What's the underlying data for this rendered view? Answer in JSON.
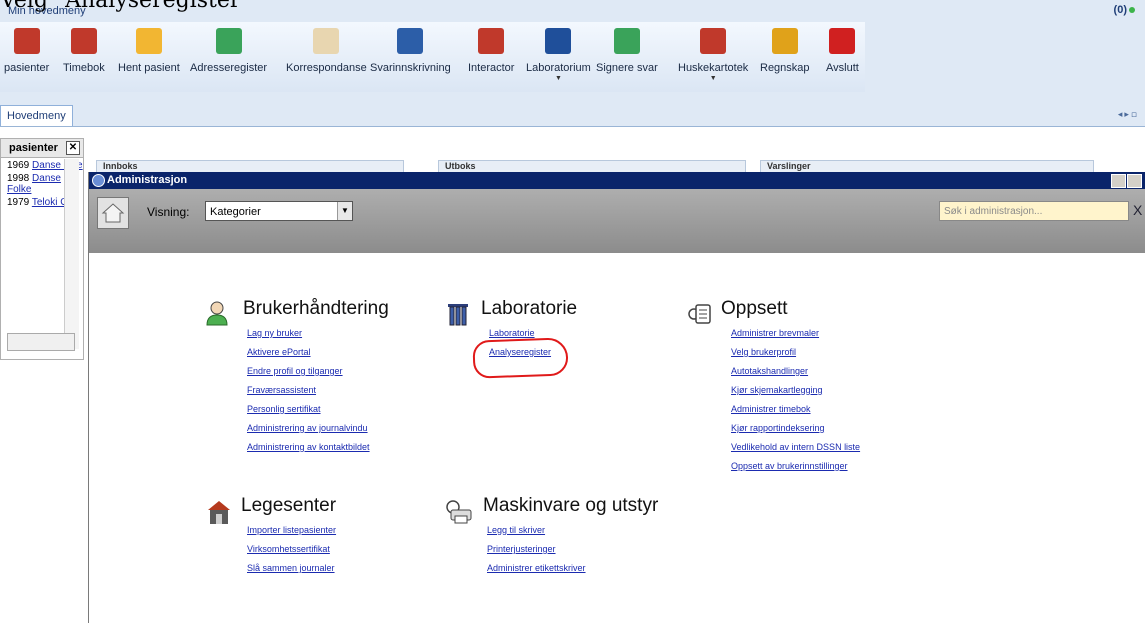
{
  "caption": "Velg \"Analyseregister\"",
  "app": {
    "title": "Min hovedmeny",
    "badge": "(0)"
  },
  "ribbon": [
    {
      "label": "pasienter",
      "icon": "calendar-icon",
      "color": "#c0392b"
    },
    {
      "label": "Timebok",
      "icon": "timebook-icon",
      "color": "#c0392b"
    },
    {
      "label": "Hent pasient",
      "icon": "fetch-patient-icon",
      "color": "#f2b632"
    },
    {
      "label": "Adresseregister",
      "icon": "address-book-icon",
      "color": "#3aa35a"
    },
    {
      "label": "Korrespondanse",
      "icon": "envelope-icon",
      "color": "#e8d6b0"
    },
    {
      "label": "Svarinnskrivning",
      "icon": "lab-entry-icon",
      "color": "#2c5ea8"
    },
    {
      "label": "Interactor",
      "icon": "interactor-icon",
      "color": "#c0392b"
    },
    {
      "label": "Laboratorium",
      "icon": "laboratory-icon",
      "color": "#1f4f9a",
      "has_menu": true
    },
    {
      "label": "Signere svar",
      "icon": "sign-check-icon",
      "color": "#3aa35a"
    },
    {
      "label": "Huskekartotek",
      "icon": "checklist-icon",
      "color": "#c0392b",
      "has_menu": true
    },
    {
      "label": "Regnskap",
      "icon": "coins-icon",
      "color": "#e0a21a"
    },
    {
      "label": "Avslutt",
      "icon": "exit-icon",
      "color": "#d02020"
    }
  ],
  "tabs": {
    "main": "Hovedmeny"
  },
  "left_pane": {
    "title": "pasienter",
    "rows": [
      {
        "year": "1969",
        "name": "Danse Line"
      },
      {
        "year": "1998",
        "name": "Danse Folke"
      },
      {
        "year": "1979",
        "name": "Teloki Gry"
      }
    ]
  },
  "background_panels": {
    "a": "Innboks",
    "b": "Utboks",
    "c": "Varslinger"
  },
  "admin": {
    "title": "Administrasjon",
    "visning_label": "Visning:",
    "visning_value": "Kategorier",
    "search_placeholder": "Søk i administrasjon...",
    "search_clear": "X",
    "categories": {
      "brukerhandtering": {
        "title": "Brukerhåndtering",
        "links": [
          "Lag ny bruker",
          "Aktivere ePortal",
          "Endre profil og tilganger",
          "Fraværsassistent",
          "Personlig sertifikat",
          "Administrering av journalvindu",
          "Administrering av kontaktbildet"
        ]
      },
      "laboratorie": {
        "title": "Laboratorie",
        "links": [
          "Laboratorie",
          "Analyseregister"
        ]
      },
      "oppsett": {
        "title": "Oppsett",
        "links": [
          "Administrer brevmaler",
          "Velg brukerprofil",
          "Autotakshandlinger",
          "Kjør skjemakartlegging",
          "Administrer timebok",
          "Kjør rapportindeksering",
          "Vedlikehold av intern DSSN liste",
          "Oppsett av brukerinnstillinger"
        ]
      },
      "legesenter": {
        "title": "Legesenter",
        "links": [
          "Importer listepasienter",
          "Virksomhetssertifikat",
          "Slå sammen journaler"
        ]
      },
      "maskinvare": {
        "title": "Maskinvare og utstyr",
        "links": [
          "Legg til skriver",
          "Printerjusteringer",
          "Administrer etikettskriver"
        ]
      }
    }
  }
}
